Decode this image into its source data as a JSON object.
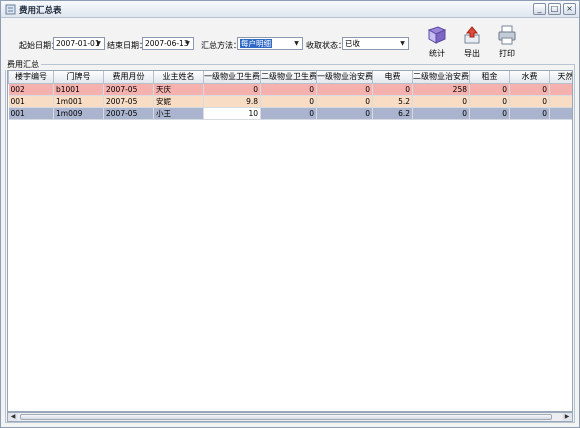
{
  "window": {
    "title": "费用汇总表",
    "controls": {
      "minimize": "_",
      "maximize": "□",
      "close": "×"
    }
  },
  "toolbar": {
    "start_date_label": "起始日期：",
    "start_date_value": "2007-01-01",
    "end_date_label": "结束日期：",
    "end_date_value": "2007-06-13",
    "method_label": "汇总方法：",
    "method_value": "每户明细",
    "status_label": "收取状态：",
    "status_value": "已收",
    "stats_label": "统计",
    "export_label": "导出",
    "print_label": "打印"
  },
  "group": {
    "legend": "费用汇总"
  },
  "table": {
    "columns": [
      "楼宇编号",
      "门牌号",
      "费用月份",
      "业主姓名",
      "一级物业卫生费",
      "二级物业卫生费",
      "一级物业治安费",
      "电费",
      "二级物业治安费",
      "租金",
      "水费",
      "天然"
    ],
    "rows": [
      [
        "002",
        "b1001",
        "2007-05",
        "天庆",
        "0",
        "0",
        "0",
        "0",
        "258",
        "0",
        "0"
      ],
      [
        "001",
        "1m001",
        "2007-05",
        "安妮",
        "9.8",
        "0",
        "0",
        "5.2",
        "0",
        "0",
        "0"
      ],
      [
        "001",
        "1m009",
        "2007-05",
        "小王",
        "10",
        "0",
        "0",
        "6.2",
        "0",
        "0",
        "0"
      ]
    ]
  },
  "scrollbar": {
    "left_arrow": "◀",
    "right_arrow": "▶"
  },
  "icons": {
    "app": "app-icon",
    "stats": "book-icon",
    "export": "export-icon",
    "print": "printer-icon"
  }
}
